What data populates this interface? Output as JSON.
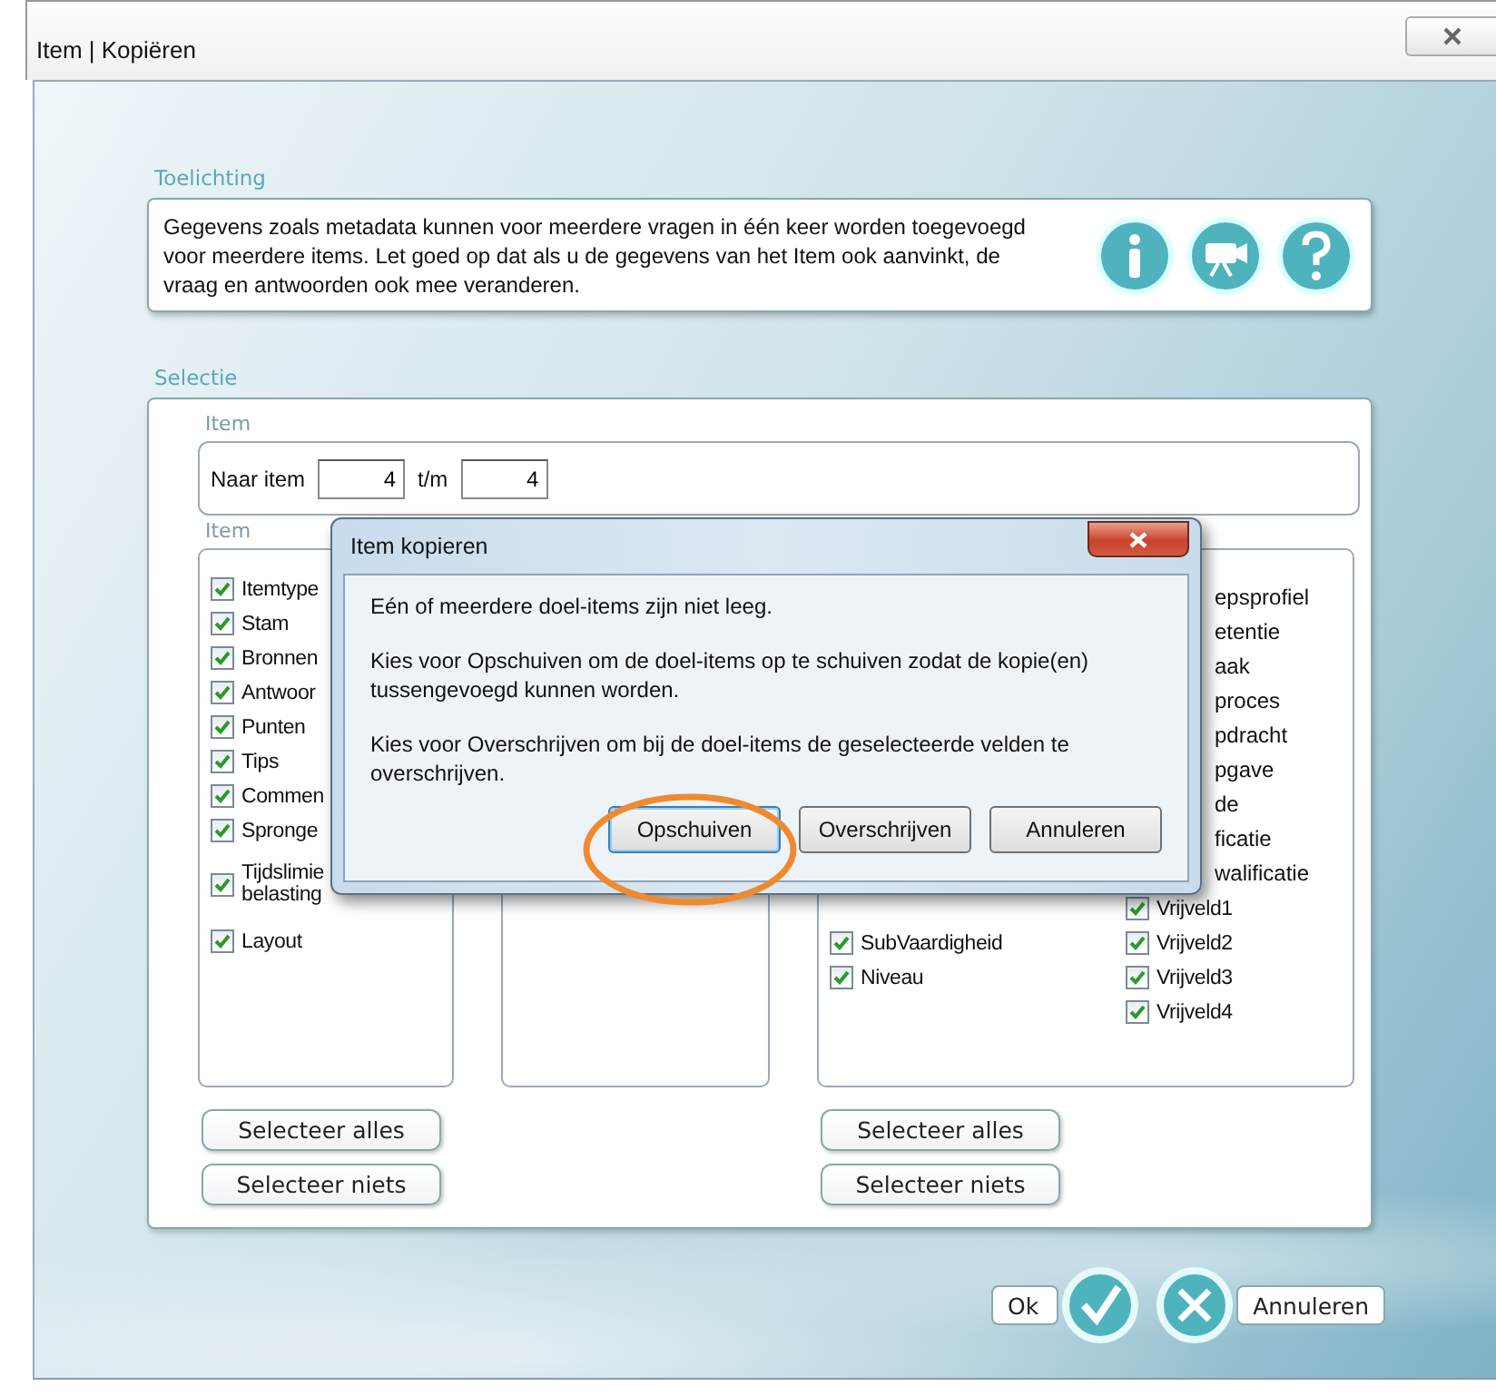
{
  "window": {
    "title": "Item | Kopiëren"
  },
  "explanation": {
    "label": "Toelichting",
    "text": "Gegevens zoals metadata kunnen voor meerdere vragen in één keer worden toegevoegd voor meerdere items. Let goed op dat als u de gegevens van het Item ook aanvinkt, de vraag en antwoorden ook mee veranderen."
  },
  "selection": {
    "label": "Selectie",
    "item_range": {
      "label": "Item",
      "from_label": "Naar item",
      "from_value": "4",
      "to_label": "t/m",
      "to_value": "4"
    },
    "left_list": {
      "label": "Item",
      "items": [
        {
          "text": "Itemtype",
          "checked": true
        },
        {
          "text": "Stam",
          "checked": true
        },
        {
          "text": "Bronnen",
          "checked": true
        },
        {
          "text": "Antwoor",
          "checked": true
        },
        {
          "text": "Punten",
          "checked": true
        },
        {
          "text": "Tips",
          "checked": true
        },
        {
          "text": "Commen",
          "checked": true
        },
        {
          "text": "Spronge",
          "checked": true
        },
        {
          "text": "Tijdslimie",
          "text_2": "belasting",
          "checked": true
        },
        {
          "text": "Layout",
          "checked": true
        }
      ]
    },
    "right_list": {
      "column_1": [
        {
          "text": "SubVaardigheid",
          "checked": true
        },
        {
          "text": "Niveau",
          "checked": true
        }
      ],
      "column_2": [
        {
          "kind": "partial",
          "text": "epsprofiel"
        },
        {
          "kind": "partial",
          "text": "etentie"
        },
        {
          "kind": "partial",
          "text": "aak"
        },
        {
          "kind": "partial",
          "text": "proces"
        },
        {
          "kind": "partial",
          "text": "pdracht"
        },
        {
          "kind": "partial",
          "text": "pgave"
        },
        {
          "kind": "partial",
          "text": "de"
        },
        {
          "kind": "partial",
          "text": "ficatie"
        },
        {
          "kind": "partial",
          "text": "walificatie"
        },
        {
          "kind": "checkbox",
          "text": "Vrijveld1",
          "checked": true
        },
        {
          "kind": "checkbox",
          "text": "Vrijveld2",
          "checked": true
        },
        {
          "kind": "checkbox",
          "text": "Vrijveld3",
          "checked": true
        },
        {
          "kind": "checkbox",
          "text": "Vrijveld4",
          "checked": true
        }
      ]
    },
    "left_buttons": [
      "Selecteer alles",
      "Selecteer niets"
    ],
    "right_buttons": [
      "Selecteer alles",
      "Selecteer niets"
    ]
  },
  "footer": {
    "ok": "Ok",
    "cancel": "Annuleren"
  },
  "dialog": {
    "title": "Item kopieren",
    "paragraphs": [
      "Eén of meerdere doel-items zijn niet leeg.",
      "Kies voor Opschuiven om de doel-items op te schuiven zodat de kopie(en) tussengevoegd kunnen worden.",
      "Kies voor Overschrijven om bij de doel-items de geselecteerde velden te overschrijven."
    ],
    "buttons": [
      {
        "label": "Opschuiven",
        "highlighted": true
      },
      {
        "label": "Overschrijven",
        "highlighted": false
      },
      {
        "label": "Annuleren",
        "highlighted": false
      }
    ]
  }
}
